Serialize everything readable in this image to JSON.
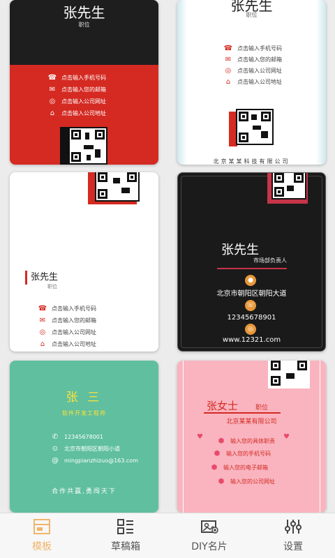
{
  "cards": [
    {
      "name": "张先生",
      "title": "职位",
      "rows": [
        "点击输入手机号码",
        "点击输入您的邮箱",
        "点击输入公司网址",
        "点击输入公司地址"
      ]
    },
    {
      "name": "张先生",
      "title": "职位",
      "rows": [
        "点击输入手机号码",
        "点击输入您的邮箱",
        "点击输入公司网址",
        "点击输入公司地址"
      ],
      "company": "北京某某科技有限公司"
    },
    {
      "name": "张先生",
      "title": "职位",
      "rows": [
        "点击输入手机号码",
        "点击输入您的邮箱",
        "点击输入公司网址",
        "点击输入公司地址"
      ]
    },
    {
      "name": "张先生",
      "title": "市场部负责人",
      "address": "北京市朝阳区朝阳大道",
      "phone": "12345678901",
      "web": "www.12321.com"
    },
    {
      "name": "张 三",
      "title": "软件开发工程师",
      "rows": [
        "12345678001",
        "北京市朝阳区朝阳小道",
        "mingpianzhizuo@163.com"
      ],
      "slogan": "合作共赢,勇闯天下"
    },
    {
      "name": "张女士",
      "title": "职位",
      "company": "北京某某有限公司",
      "rows": [
        "输入您的具体职责",
        "输入您的手机号码",
        "输入您的电子邮箱",
        "输入您的公司网址"
      ]
    }
  ],
  "tabs": [
    {
      "label": "模板",
      "icon": "template-icon",
      "active": true
    },
    {
      "label": "草稿箱",
      "icon": "drafts-icon",
      "active": false
    },
    {
      "label": "DIY名片",
      "icon": "diy-card-icon",
      "active": false
    },
    {
      "label": "设置",
      "icon": "settings-icon",
      "active": false
    }
  ],
  "colors": {
    "accent": "#f0b56a",
    "card1_red": "#d42a22",
    "card5_green": "#5fbf9e",
    "card6_pink": "#f9b4bf"
  }
}
